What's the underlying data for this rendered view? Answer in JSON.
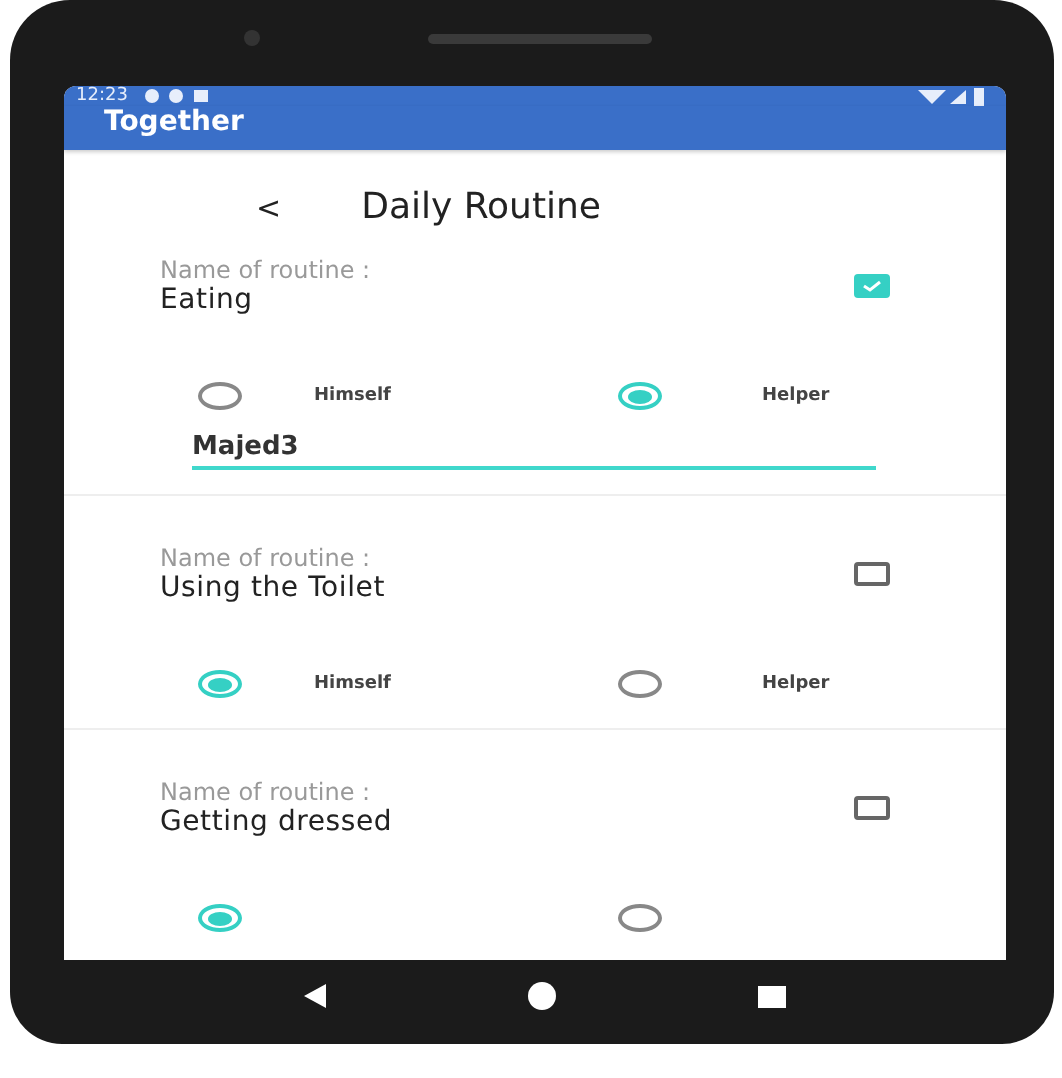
{
  "status_bar": {
    "time": "12:23"
  },
  "app_bar": {
    "title": "Together"
  },
  "header": {
    "back": "<",
    "title": "Daily Routine"
  },
  "routines": [
    {
      "label": "Name of routine :",
      "name": "Eating",
      "checked": true,
      "options": [
        {
          "label": "Himself",
          "selected": false
        },
        {
          "label": "Helper",
          "selected": true
        }
      ],
      "helper_name": "Majed3"
    },
    {
      "label": "Name of routine :",
      "name": "Using the Toilet",
      "checked": false,
      "options": [
        {
          "label": "Himself",
          "selected": true
        },
        {
          "label": "Helper",
          "selected": false
        }
      ]
    },
    {
      "label": "Name of routine :",
      "name": "Getting dressed",
      "checked": false,
      "options": [
        {
          "selected": true
        },
        {
          "selected": false
        }
      ]
    }
  ]
}
